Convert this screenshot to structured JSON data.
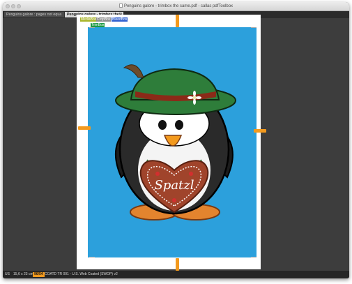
{
  "window": {
    "title": "Penguins galore - trimbox the same.pdf - callas pdfToolbox"
  },
  "tabs": [
    {
      "label": "Penguins galore : pages not equa",
      "active": false
    },
    {
      "label": "Penguins galore - trimbox the",
      "active": true,
      "close": "⊠"
    }
  ],
  "boxes": {
    "media": "MediaBox",
    "crop": "CropBox",
    "bleed": "BleedBox",
    "trim": "TrimBox"
  },
  "artwork": {
    "heart_text": "Spatzl"
  },
  "statusbar": {
    "units": "US",
    "page_size": "15,6 x 23 cm",
    "badge": "96/54",
    "output_intent": "COATD TR 001 - U.S. Web Coated (SWOP) v2"
  },
  "colors": {
    "trim_background": "#2ca0dc",
    "handle": "#f39a1e",
    "hat": "#2e7d3a",
    "heart": "#a0442b"
  }
}
